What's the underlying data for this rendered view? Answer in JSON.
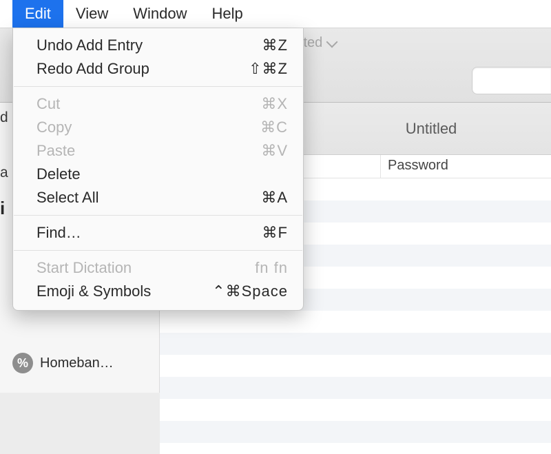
{
  "menuBar": {
    "items": [
      "Edit",
      "View",
      "Window",
      "Help"
    ],
    "selectedIndex": 0
  },
  "editMenu": {
    "groups": [
      [
        {
          "label": "Undo Add Entry",
          "shortcut": "⌘Z",
          "enabled": true
        },
        {
          "label": "Redo Add Group",
          "shortcut": "⇧⌘Z",
          "enabled": true
        }
      ],
      [
        {
          "label": "Cut",
          "shortcut": "⌘X",
          "enabled": false
        },
        {
          "label": "Copy",
          "shortcut": "⌘C",
          "enabled": false
        },
        {
          "label": "Paste",
          "shortcut": "⌘V",
          "enabled": false
        },
        {
          "label": "Delete",
          "shortcut": "",
          "enabled": true
        },
        {
          "label": "Select All",
          "shortcut": "⌘A",
          "enabled": true
        }
      ],
      [
        {
          "label": "Find…",
          "shortcut": "⌘F",
          "enabled": true
        }
      ],
      [
        {
          "label": "Start Dictation",
          "shortcut": "fn fn",
          "enabled": false
        },
        {
          "label": "Emoji & Symbols",
          "shortcut": "⌃⌘Space",
          "enabled": true
        }
      ]
    ]
  },
  "window": {
    "titleMain": "Untitled",
    "titleSub": "Edited"
  },
  "main": {
    "groupTitle": "Untitled",
    "columns": {
      "password": "Password"
    }
  },
  "sidebar": {
    "fragments": {
      "p1": "d",
      "p2": "a",
      "p3": "i"
    },
    "item": {
      "glyph": "%",
      "label": "Homeban…"
    }
  }
}
